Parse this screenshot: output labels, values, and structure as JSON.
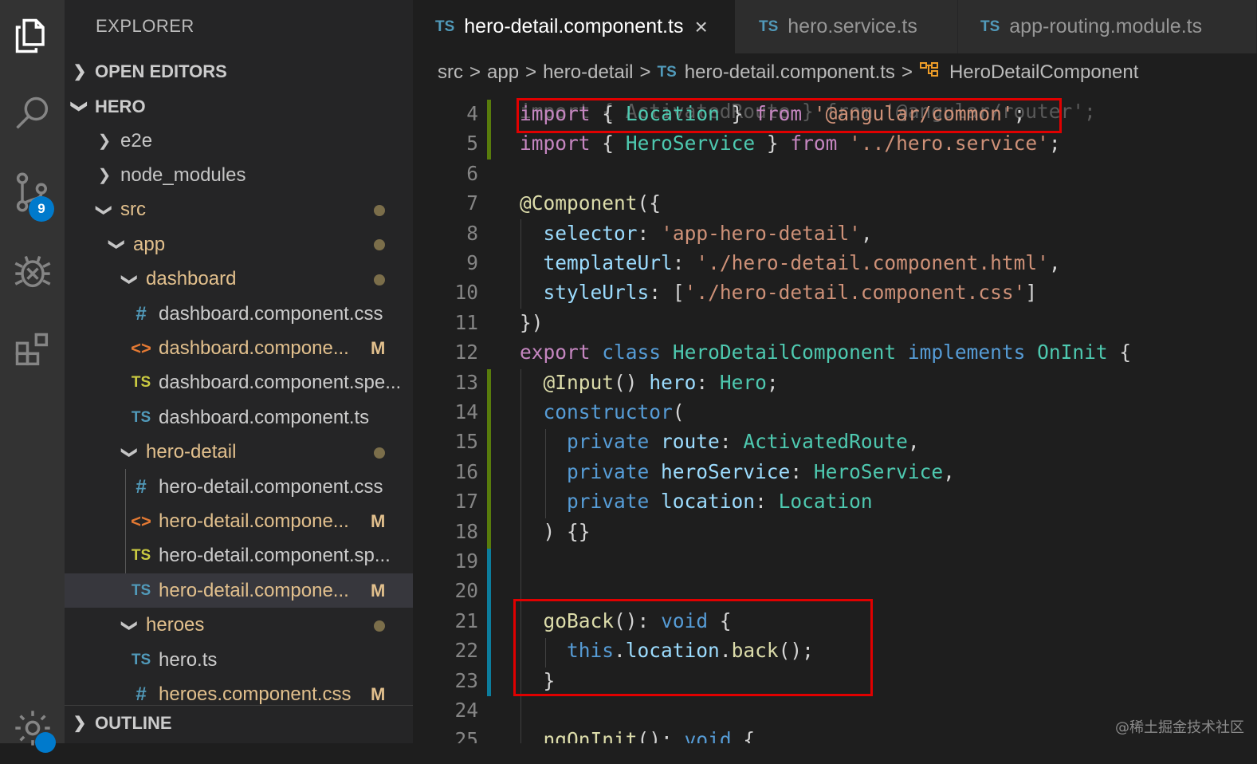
{
  "activity_bar": {
    "items": [
      {
        "name": "explorer-icon"
      },
      {
        "name": "search-icon"
      },
      {
        "name": "source-control-icon",
        "badge": "9"
      },
      {
        "name": "debug-icon"
      },
      {
        "name": "extensions-icon"
      },
      {
        "name": "settings-gear-icon"
      }
    ]
  },
  "sidebar": {
    "title": "EXPLORER",
    "sections": {
      "open_editors": "OPEN EDITORS",
      "project": "HERO",
      "outline": "OUTLINE"
    },
    "tree": [
      {
        "label": "e2e",
        "kind": "folder",
        "expanded": false
      },
      {
        "label": "node_modules",
        "kind": "folder",
        "expanded": false
      },
      {
        "label": "src",
        "kind": "folder",
        "expanded": true,
        "modified_dot": true
      },
      {
        "label": "app",
        "kind": "folder",
        "expanded": true,
        "modified_dot": true
      },
      {
        "label": "dashboard",
        "kind": "folder",
        "expanded": true,
        "modified_dot": true
      },
      {
        "label": "dashboard.component.css",
        "kind": "css",
        "icon": "#"
      },
      {
        "label": "dashboard.compone...",
        "kind": "html",
        "icon": "<>",
        "status": "M"
      },
      {
        "label": "dashboard.component.spe...",
        "kind": "spec",
        "icon": "TS"
      },
      {
        "label": "dashboard.component.ts",
        "kind": "ts",
        "icon": "TS"
      },
      {
        "label": "hero-detail",
        "kind": "folder",
        "expanded": true,
        "modified_dot": true
      },
      {
        "label": "hero-detail.component.css",
        "kind": "css",
        "icon": "#"
      },
      {
        "label": "hero-detail.compone...",
        "kind": "html",
        "icon": "<>",
        "status": "M"
      },
      {
        "label": "hero-detail.component.sp...",
        "kind": "spec",
        "icon": "TS"
      },
      {
        "label": "hero-detail.compone...",
        "kind": "ts",
        "icon": "TS",
        "status": "M",
        "selected": true
      },
      {
        "label": "heroes",
        "kind": "folder",
        "expanded": true,
        "modified_dot": true
      },
      {
        "label": "hero.ts",
        "kind": "ts",
        "icon": "TS"
      },
      {
        "label": "heroes.component.css",
        "kind": "css",
        "icon": "#",
        "status": "M"
      }
    ]
  },
  "tabs": [
    {
      "prefix": "TS",
      "label": "hero-detail.component.ts",
      "active": true,
      "close": "×"
    },
    {
      "prefix": "TS",
      "label": "hero.service.ts",
      "active": false
    },
    {
      "prefix": "TS",
      "label": "app-routing.module.ts",
      "active": false
    }
  ],
  "breadcrumb": {
    "parts": [
      "src",
      "app",
      "hero-detail"
    ],
    "file_prefix": "TS",
    "file": "hero-detail.component.ts",
    "symbol": "HeroDetailComponent",
    "separator": ">"
  },
  "editor": {
    "partial_top_line": "import { ActivatedRoute } from '@angular/router';",
    "lines": [
      {
        "n": "4",
        "text": "import { Location } from '@angular/common';"
      },
      {
        "n": "5",
        "text": "import { HeroService } from '../hero.service';"
      },
      {
        "n": "6",
        "text": ""
      },
      {
        "n": "7",
        "text": "@Component({"
      },
      {
        "n": "8",
        "text": "  selector: 'app-hero-detail',"
      },
      {
        "n": "9",
        "text": "  templateUrl: './hero-detail.component.html',"
      },
      {
        "n": "10",
        "text": "  styleUrls: ['./hero-detail.component.css']"
      },
      {
        "n": "11",
        "text": "})"
      },
      {
        "n": "12",
        "text": "export class HeroDetailComponent implements OnInit {"
      },
      {
        "n": "13",
        "text": "  @Input() hero: Hero;"
      },
      {
        "n": "14",
        "text": "  constructor("
      },
      {
        "n": "15",
        "text": "    private route: ActivatedRoute,"
      },
      {
        "n": "16",
        "text": "    private heroService: HeroService,"
      },
      {
        "n": "17",
        "text": "    private location: Location"
      },
      {
        "n": "18",
        "text": "  ) {}"
      },
      {
        "n": "19",
        "text": ""
      },
      {
        "n": "20",
        "text": ""
      },
      {
        "n": "21",
        "text": "  goBack(): void {"
      },
      {
        "n": "22",
        "text": "    this.location.back();"
      },
      {
        "n": "23",
        "text": "  }"
      },
      {
        "n": "24",
        "text": ""
      },
      {
        "n": "25",
        "text": "  ngOnInit(): void {"
      }
    ]
  },
  "watermark": "@稀土掘金技术社区",
  "colors": {
    "highlight_box": "#e00000",
    "git_added": "#587c0c",
    "git_modified": "#0c7d9d",
    "accent": "#007acc"
  }
}
